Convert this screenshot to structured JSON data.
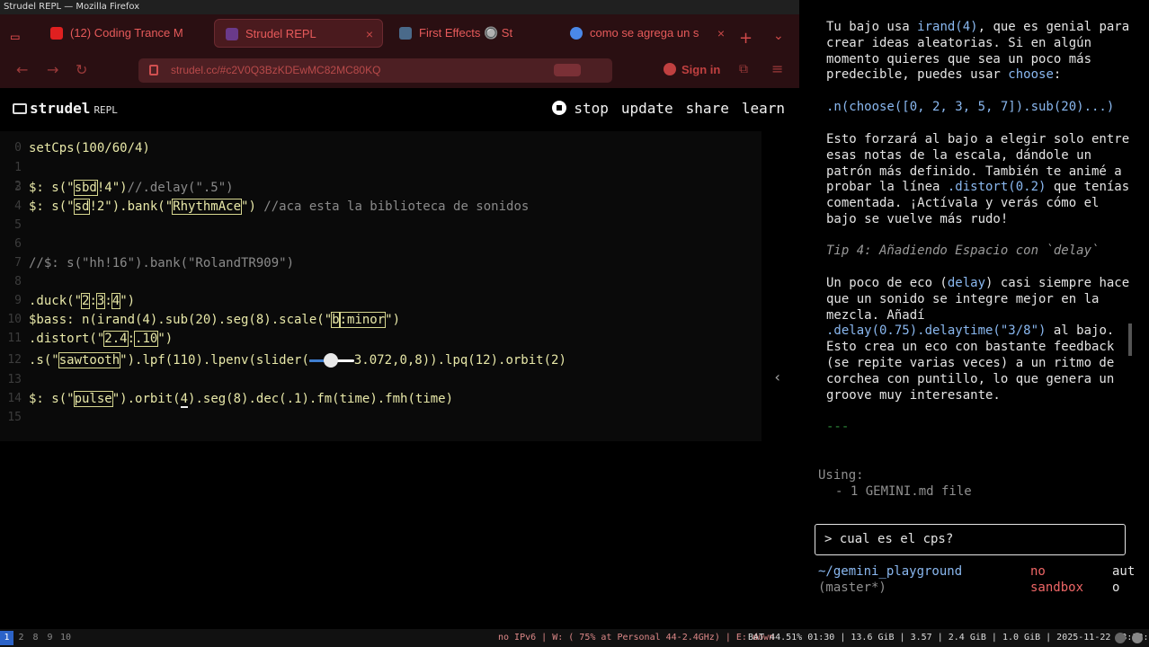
{
  "window": {
    "title": "Strudel REPL — Mozilla Firefox"
  },
  "tabs": [
    {
      "label": "(12) Coding Trance M",
      "color": "#e84a4a"
    },
    {
      "label": "Strudel REPL",
      "active": true
    },
    {
      "label": "First Effects 🔘 St"
    },
    {
      "label": "como se agrega un s"
    }
  ],
  "nav": {
    "url": "strudel.cc/#c2V0Q3BzKDEwMC82MC80KQ",
    "signin": "Sign in"
  },
  "strudel": {
    "logo": "strudel",
    "logo_sub": "REPL",
    "menu": {
      "stop": "stop",
      "update": "update",
      "share": "share",
      "learn": "learn"
    }
  },
  "code": {
    "l0": "setCps(100/60/4)",
    "l3a": "$: s(\"",
    "l3b": "sbd",
    "l3c": "!4\")",
    "l3d": "//.delay(\".5\")",
    "l4a": "$: s(\"",
    "l4b": "sd",
    "l4c": "!2\").bank(\"",
    "l4d": "RhythmAce",
    "l4e": "\")",
    "l4f": " //aca esta la biblioteca de sonidos",
    "l7": "//$: s(\"hh!16\").bank(\"RolandTR909\")",
    "l9a": ".duck(\"",
    "l9b": "2",
    "l9c": ":",
    "l9d": "3",
    "l9e": ":",
    "l9f": "4",
    "l9g": "\")",
    "l10a": "$bass: n(irand(4).sub(20).seg(8).scale(\"",
    "l10b": "b",
    "l10c": ":minor",
    "l10d": "\")",
    "l11a": ".distort(\"",
    "l11b": "2.4",
    "l11c": ":",
    "l11d": ".10",
    "l11e": "\")",
    "l12a": ".s(\"",
    "l12b": "sawtooth",
    "l12c": "\").lpf(110).lpenv(slider(",
    "l12d": "3.072,0,8)).lpq(12).orbit(2)",
    "l14a": "$: s(\"",
    "l14b": "pulse",
    "l14c": "\").orbit(",
    "l14d": "4",
    "l14e": ").seg(8).dec(.1).fm(time).fmh(time)",
    "slider_value": 3.072
  },
  "terminal": {
    "p1a": "Tu bajo usa ",
    "p1b": "irand(4)",
    "p1c": ", que es genial para crear ideas aleatorias. Si en algún momento quieres que sea un poco más predecible, puedes usar ",
    "p1d": "choose",
    "p1e": ":",
    "code1": ".n(choose([0, 2, 3, 5, 7]).sub(20)...)",
    "p2a": "Esto forzará al bajo a elegir solo entre esas notas de la escala, dándole un patrón más definido. También te animé a probar la línea ",
    "p2b": ".distort(0.2)",
    "p2c": " que tenías comentada. ¡Actívala y verás cómo el bajo se vuelve más rudo!",
    "tip": "Tip 4: Añadiendo Espacio con `delay`",
    "p3a": "Un poco de eco (",
    "p3b": "delay",
    "p3c": ") casi siempre hace que un sonido se integre mejor en la mezcla. Añadí ",
    "p3d": ".delay(0.75).delaytime(\"3/8\")",
    "p3e": " al bajo. Esto crea un eco con bastante feedback (se repite varias veces) a un ritmo de corchea con puntillo, lo que genera un groove muy interesante.",
    "dashes": "---",
    "using": "Using:",
    "using_item": "- 1 GEMINI.md file",
    "prompt": "> cual es el cps?",
    "dir": "~/gemini_playground",
    "branch": "(master*)",
    "sandbox1": "no",
    "sandbox2": "sandbox",
    "model1": "aut",
    "model2": "o"
  },
  "statusbar": {
    "workspaces": [
      "1",
      "2",
      "8",
      "9",
      "10"
    ],
    "net": "no IPv6 | W: ( 75% at Personal 44-2.4GHz) | E: down",
    "bat": "BAT 44.51% 01:30 | 13.6 GiB | 3.57 | 2.4 GiB | 1.0 GiB | 2025-11-22 13:52:05"
  }
}
